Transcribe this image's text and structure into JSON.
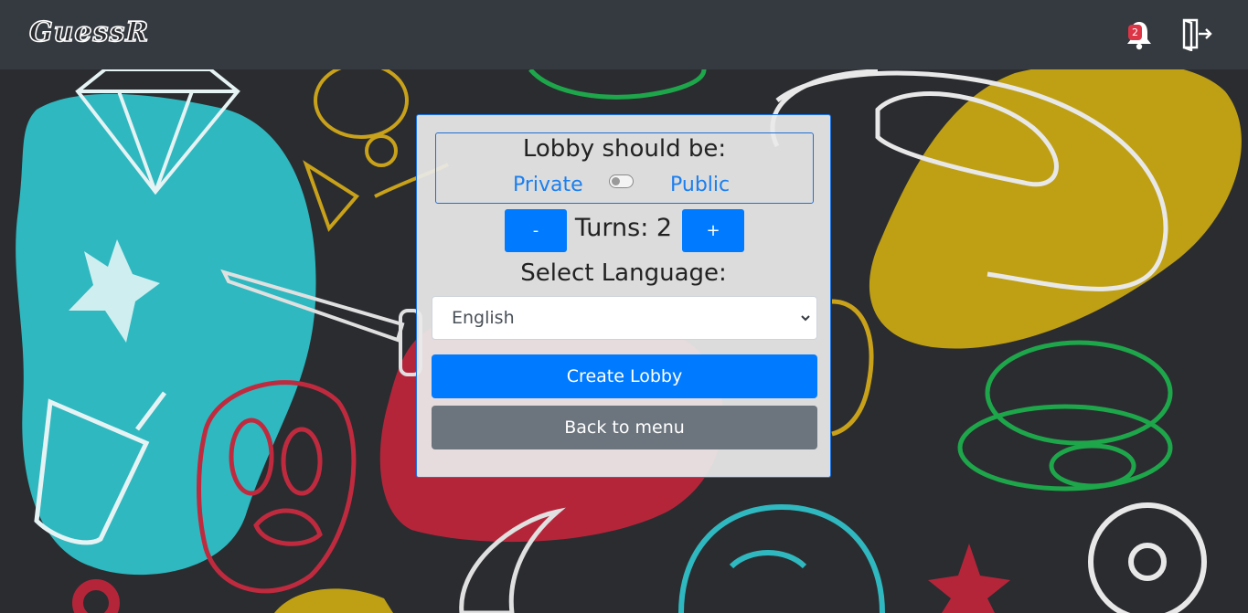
{
  "navbar": {
    "brand": "GuessR",
    "notification_count": "2",
    "icons": {
      "notifications": "bell-icon",
      "logout": "logout-icon"
    }
  },
  "colors": {
    "navbar_bg": "#343a40",
    "primary": "#007bff",
    "secondary": "#6c757d",
    "badge": "#dc3545",
    "blob_teal": "#2fb8bf",
    "blob_gold": "#bfa015",
    "blob_red": "#b5253a",
    "doodle_green": "#1ea64a"
  },
  "lobby_form": {
    "privacy_title": "Lobby should be:",
    "private_label": "Private",
    "public_label": "Public",
    "public_enabled": false,
    "turns_text": "Turns: 2",
    "decrement_label": "-",
    "increment_label": "+",
    "language_title": "Select Language:",
    "language_selected": "English",
    "create_label": "Create Lobby",
    "back_label": "Back to menu"
  }
}
